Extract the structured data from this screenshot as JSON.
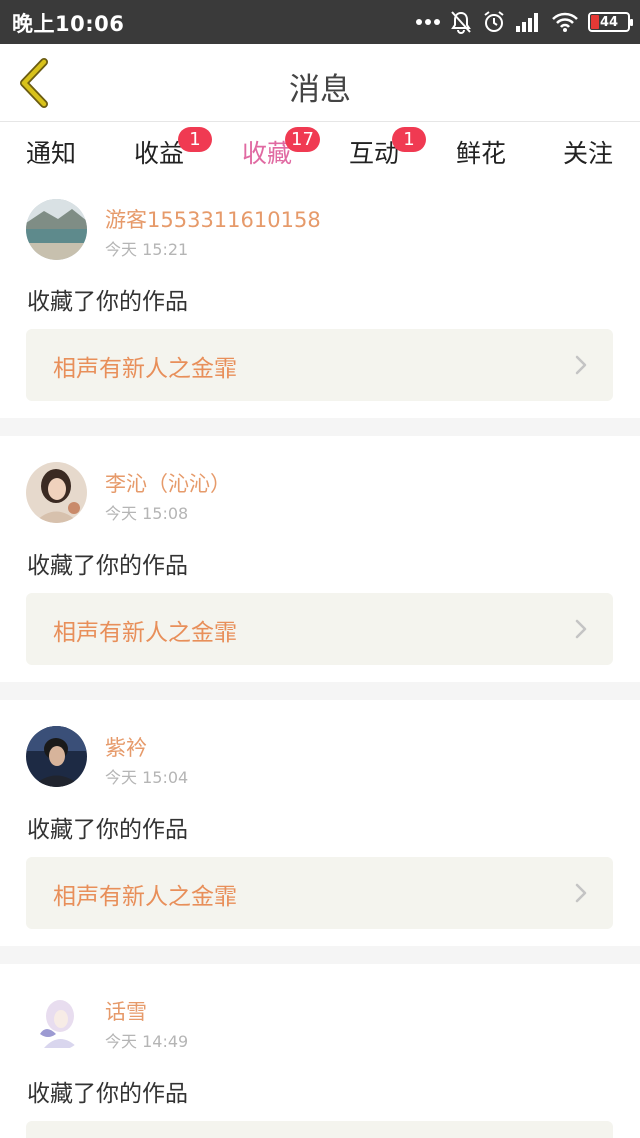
{
  "status_bar": {
    "time": "晚上10:06",
    "battery_level": "44",
    "icons": [
      "more-dots-icon",
      "bell-off-icon",
      "alarm-icon",
      "signal-icon",
      "wifi-icon",
      "battery-icon"
    ]
  },
  "header": {
    "title": "消息",
    "back_icon": "chevron-left-icon"
  },
  "tabs": [
    {
      "label": "通知",
      "badge": "",
      "active": false
    },
    {
      "label": "收益",
      "badge": "1",
      "active": false
    },
    {
      "label": "收藏",
      "badge": "17",
      "active": true
    },
    {
      "label": "互动",
      "badge": "1",
      "active": false
    },
    {
      "label": "鲜花",
      "badge": "",
      "active": false
    },
    {
      "label": "关注",
      "badge": "",
      "active": false
    }
  ],
  "items": [
    {
      "username": "游客1553311610158",
      "time": "今天 15:21",
      "action": "收藏了你的作品",
      "work": "相声有新人之金霏"
    },
    {
      "username": "李沁（沁沁）",
      "time": "今天 15:08",
      "action": "收藏了你的作品",
      "work": "相声有新人之金霏"
    },
    {
      "username": "紫衿",
      "time": "今天 15:04",
      "action": "收藏了你的作品",
      "work": "相声有新人之金霏"
    },
    {
      "username": "话雪",
      "time": "今天 14:49",
      "action": "收藏了你的作品",
      "work": ""
    }
  ],
  "colors": {
    "accent": "#e06aa2",
    "badge": "#f03a52",
    "username": "#e69a6a",
    "work_title": "#e88f5a",
    "back_arrow": "#d8c21a",
    "status_bar": "#3a3a3a"
  }
}
